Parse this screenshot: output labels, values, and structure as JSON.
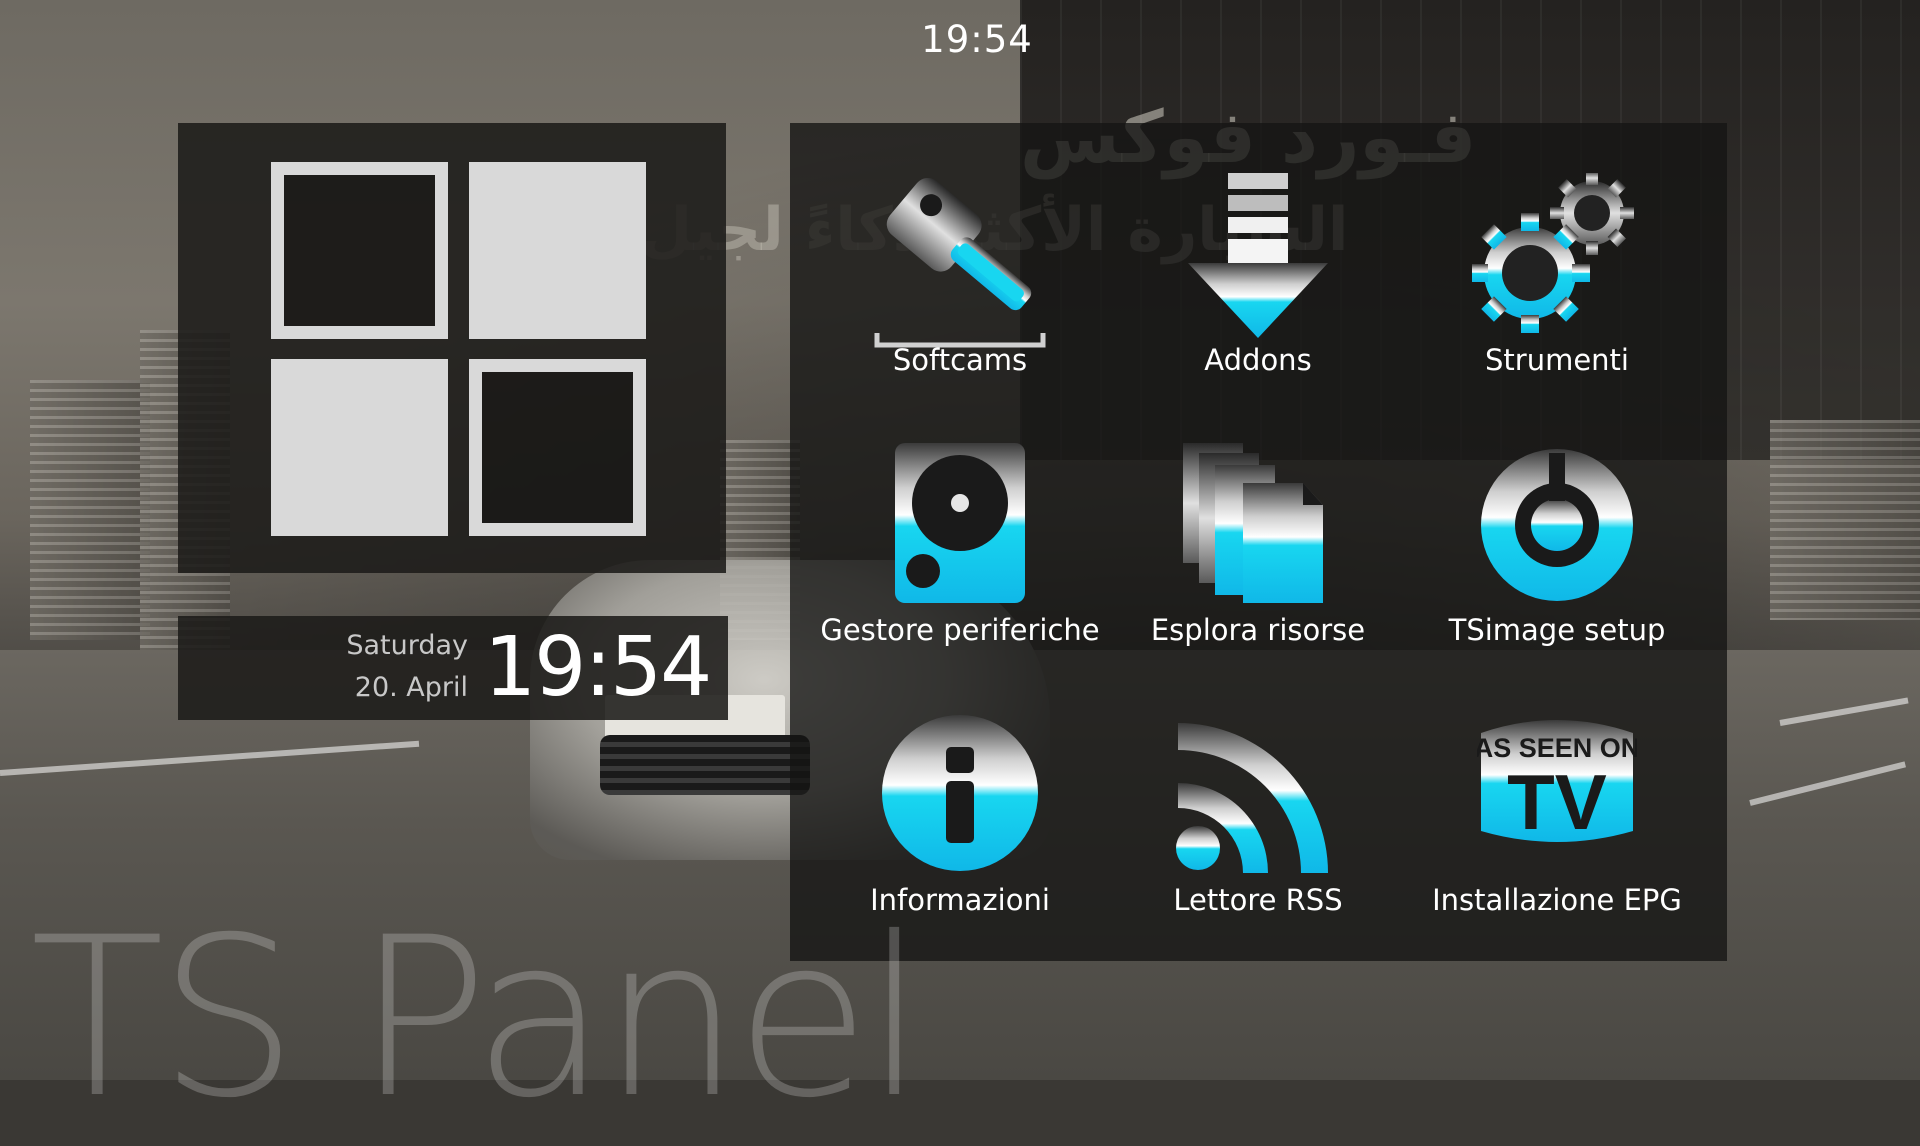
{
  "top_clock": "19:54",
  "date_panel": {
    "weekday": "Saturday",
    "date": "20. April",
    "time": "19:54"
  },
  "background": {
    "ad_line1": "فـورد فوكس",
    "ad_line2": "السيارة الأكثر ذكاءً لجيل"
  },
  "menu": {
    "items": [
      {
        "label": "Softcams",
        "icon": "key-icon"
      },
      {
        "label": "Addons",
        "icon": "download-arrow-icon"
      },
      {
        "label": "Strumenti",
        "icon": "gears-icon"
      },
      {
        "label": "Gestore periferiche",
        "icon": "hard-disk-icon"
      },
      {
        "label": "Esplora risorse",
        "icon": "files-icon"
      },
      {
        "label": "TSimage setup",
        "icon": "power-dial-icon"
      },
      {
        "label": "Informazioni",
        "icon": "info-icon"
      },
      {
        "label": "Lettore RSS",
        "icon": "rss-icon"
      },
      {
        "label": "Installazione EPG",
        "icon": "as-seen-on-tv-icon"
      }
    ]
  },
  "tv_logo": {
    "line1": "AS SEEN ON",
    "line2": "TV"
  },
  "panel_title": "TS Panel",
  "colors": {
    "accent": "#18d6f0",
    "tile": "#d9d9d9",
    "panel": "#1c1b19"
  }
}
